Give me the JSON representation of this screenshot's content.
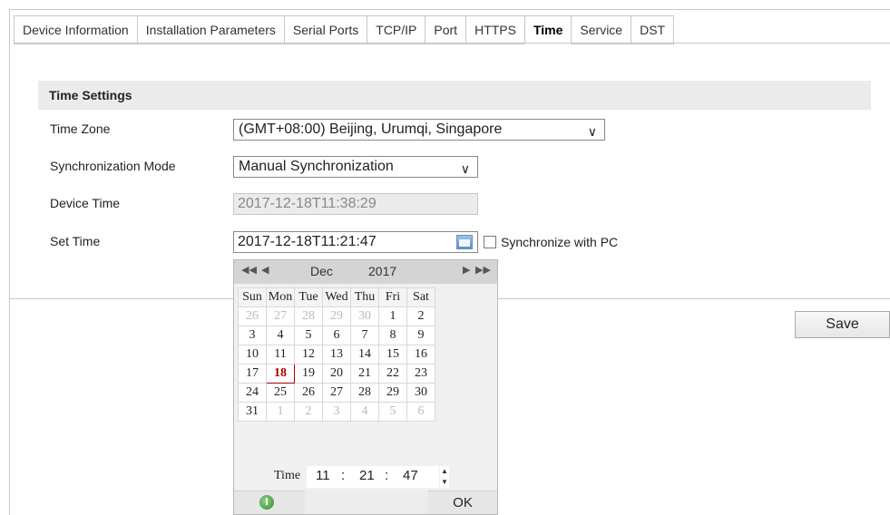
{
  "tabs": [
    {
      "label": "Device Information"
    },
    {
      "label": "Installation Parameters"
    },
    {
      "label": "Serial Ports"
    },
    {
      "label": "TCP/IP"
    },
    {
      "label": "Port"
    },
    {
      "label": "HTTPS"
    },
    {
      "label": "Time",
      "active": true
    },
    {
      "label": "Service"
    },
    {
      "label": "DST"
    }
  ],
  "section": {
    "title": "Time Settings"
  },
  "form": {
    "time_zone_label": "Time Zone",
    "time_zone_value": "(GMT+08:00) Beijing, Urumqi, Singapore",
    "sync_mode_label": "Synchronization Mode",
    "sync_mode_value": "Manual Synchronization",
    "device_time_label": "Device Time",
    "device_time_value": "2017-12-18T11:38:29",
    "set_time_label": "Set Time",
    "set_time_value": "2017-12-18T11:21:47",
    "sync_pc_label": "Synchronize with PC",
    "sync_pc_checked": false
  },
  "save_label": "Save",
  "picker": {
    "nav_prev_year": "◀◀",
    "nav_prev_month": "◀",
    "nav_next_month": "▶",
    "nav_next_year": "▶▶",
    "month": "Dec",
    "year": "2017",
    "weekdays": [
      "Sun",
      "Mon",
      "Tue",
      "Wed",
      "Thu",
      "Fri",
      "Sat"
    ],
    "weeks": [
      [
        "26",
        "27",
        "28",
        "29",
        "30",
        "1",
        "2"
      ],
      [
        "3",
        "4",
        "5",
        "6",
        "7",
        "8",
        "9"
      ],
      [
        "10",
        "11",
        "12",
        "13",
        "14",
        "15",
        "16"
      ],
      [
        "17",
        "18",
        "19",
        "20",
        "21",
        "22",
        "23"
      ],
      [
        "24",
        "25",
        "26",
        "27",
        "28",
        "29",
        "30"
      ],
      [
        "31",
        "1",
        "2",
        "3",
        "4",
        "5",
        "6"
      ]
    ],
    "selected_day": "18",
    "time_label": "Time",
    "hour": "11",
    "minute": "21",
    "second": "47",
    "separator": ":",
    "ok_label": "OK"
  }
}
